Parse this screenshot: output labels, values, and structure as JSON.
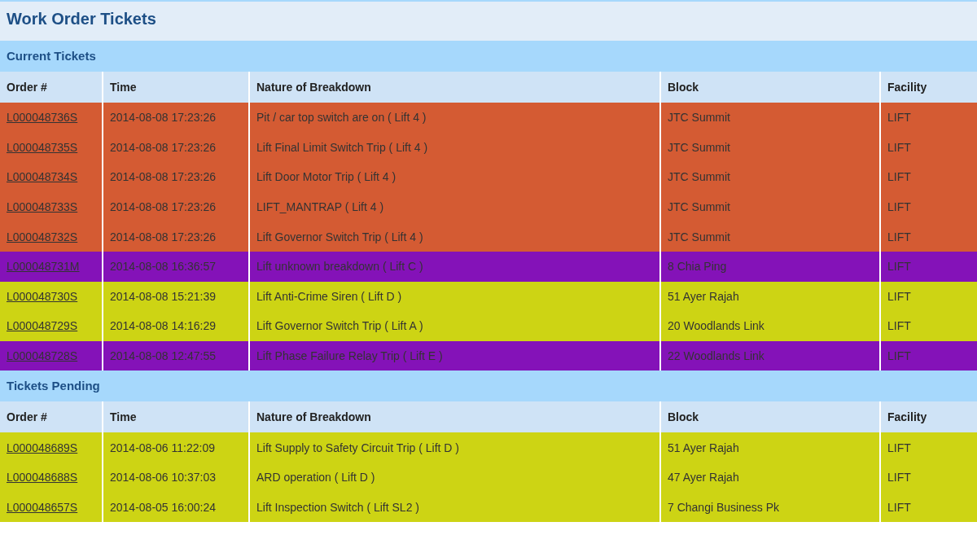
{
  "title": "Work Order Tickets",
  "sections": [
    {
      "heading": "Current Tickets",
      "columns": [
        "Order #",
        "Time",
        "Nature of Breakdown",
        "Block",
        "Facility"
      ],
      "rows": [
        {
          "order": "L000048736S",
          "time": "2014-08-08 17:23:26",
          "nature": "Pit / car top switch are on ( Lift 4 )",
          "block": "JTC Summit",
          "facility": "LIFT",
          "color": "#d45b33"
        },
        {
          "order": "L000048735S",
          "time": "2014-08-08 17:23:26",
          "nature": "Lift Final Limit Switch Trip ( Lift 4 )",
          "block": "JTC Summit",
          "facility": "LIFT",
          "color": "#d45b33"
        },
        {
          "order": "L000048734S",
          "time": "2014-08-08 17:23:26",
          "nature": "Lift Door Motor Trip ( Lift 4 )",
          "block": "JTC Summit",
          "facility": "LIFT",
          "color": "#d45b33"
        },
        {
          "order": "L000048733S",
          "time": "2014-08-08 17:23:26",
          "nature": "LIFT_MANTRAP ( Lift 4 )",
          "block": "JTC Summit",
          "facility": "LIFT",
          "color": "#d45b33"
        },
        {
          "order": "L000048732S",
          "time": "2014-08-08 17:23:26",
          "nature": "Lift Governor Switch Trip ( Lift 4 )",
          "block": "JTC Summit",
          "facility": "LIFT",
          "color": "#d45b33"
        },
        {
          "order": "L000048731M",
          "time": "2014-08-08 16:36:57",
          "nature": "Lift unknown breakdown ( Lift C )",
          "block": "8 Chia Ping",
          "facility": "LIFT",
          "color": "#8412b8"
        },
        {
          "order": "L000048730S",
          "time": "2014-08-08 15:21:39",
          "nature": "Lift Anti-Crime Siren ( Lift D )",
          "block": "51 Ayer Rajah",
          "facility": "LIFT",
          "color": "#cdd414"
        },
        {
          "order": "L000048729S",
          "time": "2014-08-08 14:16:29",
          "nature": "Lift Governor Switch Trip ( Lift A )",
          "block": "20 Woodlands Link",
          "facility": "LIFT",
          "color": "#cdd414"
        },
        {
          "order": "L000048728S",
          "time": "2014-08-08 12:47:55",
          "nature": "Lift Phase Failure Relay Trip ( Lift E )",
          "block": "22 Woodlands Link",
          "facility": "LIFT",
          "color": "#8412b8"
        }
      ]
    },
    {
      "heading": "Tickets Pending",
      "columns": [
        "Order #",
        "Time",
        "Nature of Breakdown",
        "Block",
        "Facility"
      ],
      "rows": [
        {
          "order": "L000048689S",
          "time": "2014-08-06 11:22:09",
          "nature": "Lift Supply to Safety Circuit Trip ( Lift D )",
          "block": "51 Ayer Rajah",
          "facility": "LIFT",
          "color": "#cdd414"
        },
        {
          "order": "L000048688S",
          "time": "2014-08-06 10:37:03",
          "nature": "ARD operation ( Lift D )",
          "block": "47 Ayer Rajah",
          "facility": "LIFT",
          "color": "#cdd414"
        },
        {
          "order": "L000048657S",
          "time": "2014-08-05 16:00:24",
          "nature": "Lift Inspection Switch ( Lift SL2 )",
          "block": "7 Changi Business Pk",
          "facility": "LIFT",
          "color": "#cdd414"
        }
      ]
    }
  ]
}
